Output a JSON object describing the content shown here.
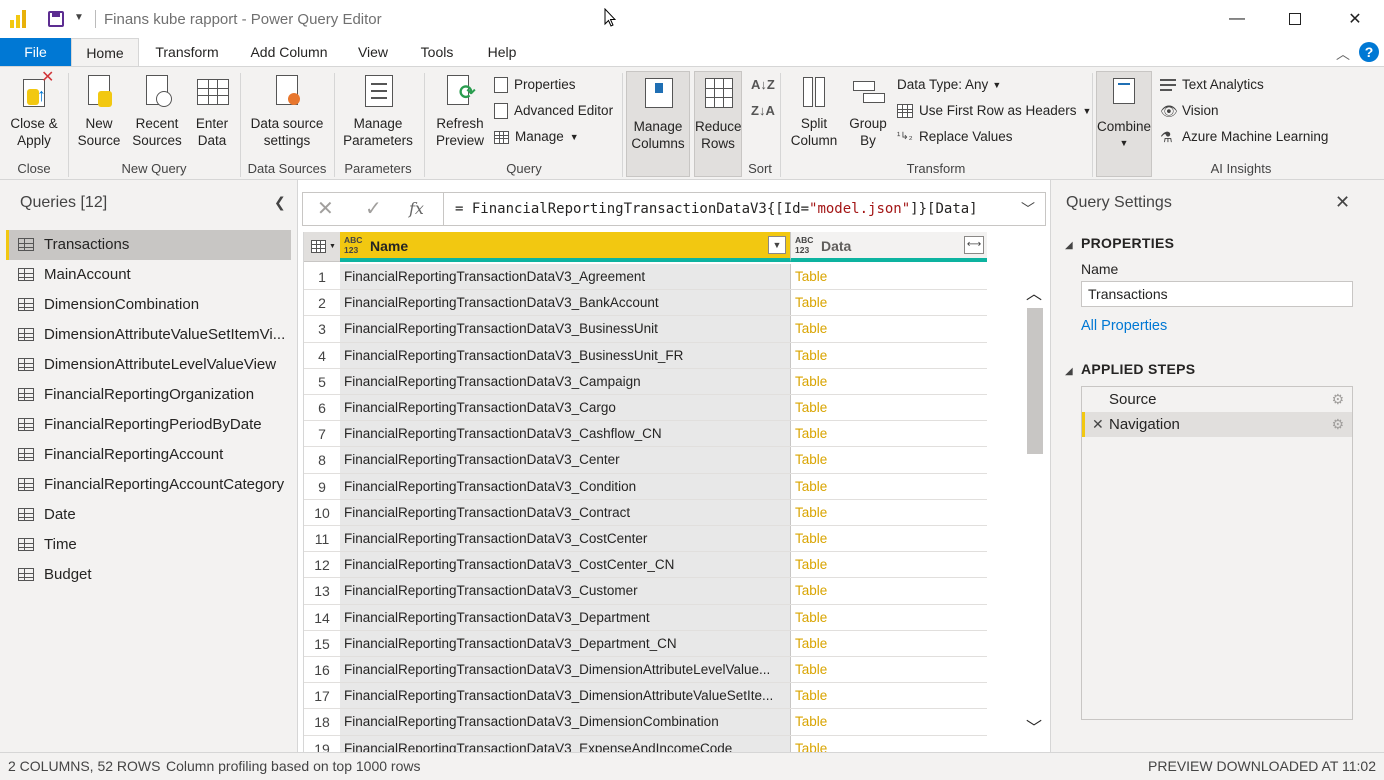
{
  "window": {
    "title": "Finans kube rapport - Power Query Editor",
    "minimize": "—",
    "close": "✕"
  },
  "tabs": [
    {
      "label": "File"
    },
    {
      "label": "Home"
    },
    {
      "label": "Transform"
    },
    {
      "label": "Add Column"
    },
    {
      "label": "View"
    },
    {
      "label": "Tools"
    },
    {
      "label": "Help"
    }
  ],
  "ribbon": {
    "close_apply": "Close &\nApply",
    "new_source": "New\nSource",
    "recent_sources": "Recent\nSources",
    "enter_data": "Enter\nData",
    "data_source_settings": "Data source\nsettings",
    "manage_parameters": "Manage\nParameters",
    "refresh_preview": "Refresh\nPreview",
    "properties": "Properties",
    "advanced_editor": "Advanced Editor",
    "manage": "Manage",
    "manage_columns": "Manage\nColumns",
    "reduce_rows": "Reduce\nRows",
    "split_column": "Split\nColumn",
    "group_by": "Group\nBy",
    "data_type": "Data Type: Any",
    "use_first_row": "Use First Row as Headers",
    "replace_values": "Replace Values",
    "combine": "Combine",
    "text_analytics": "Text Analytics",
    "vision": "Vision",
    "azure_ml": "Azure Machine Learning",
    "groups": {
      "close": "Close",
      "new_query": "New Query",
      "data_sources": "Data Sources",
      "parameters": "Parameters",
      "query": "Query",
      "sort": "Sort",
      "transform": "Transform",
      "ai_insights": "AI Insights"
    }
  },
  "queries": {
    "title": "Queries [12]",
    "items": [
      "Transactions",
      "MainAccount",
      "DimensionCombination",
      "DimensionAttributeValueSetItemVi...",
      "DimensionAttributeLevelValueView",
      "FinancialReportingOrganization",
      "FinancialReportingPeriodByDate",
      "FinancialReportingAccount",
      "FinancialReportingAccountCategory",
      "Date",
      "Time",
      "Budget"
    ],
    "selected": "Transactions"
  },
  "formula": {
    "prefix": "= FinancialReportingTransactionDataV3{[Id=",
    "string": "\"model.json\"",
    "suffix": "]}[Data]"
  },
  "grid": {
    "columns": [
      {
        "type": "ABC\n123",
        "name": "Name"
      },
      {
        "type": "ABC\n123",
        "name": "Data"
      }
    ],
    "rows": [
      [
        "1",
        "FinancialReportingTransactionDataV3_Agreement",
        "Table"
      ],
      [
        "2",
        "FinancialReportingTransactionDataV3_BankAccount",
        "Table"
      ],
      [
        "3",
        "FinancialReportingTransactionDataV3_BusinessUnit",
        "Table"
      ],
      [
        "4",
        "FinancialReportingTransactionDataV3_BusinessUnit_FR",
        "Table"
      ],
      [
        "5",
        "FinancialReportingTransactionDataV3_Campaign",
        "Table"
      ],
      [
        "6",
        "FinancialReportingTransactionDataV3_Cargo",
        "Table"
      ],
      [
        "7",
        "FinancialReportingTransactionDataV3_Cashflow_CN",
        "Table"
      ],
      [
        "8",
        "FinancialReportingTransactionDataV3_Center",
        "Table"
      ],
      [
        "9",
        "FinancialReportingTransactionDataV3_Condition",
        "Table"
      ],
      [
        "10",
        "FinancialReportingTransactionDataV3_Contract",
        "Table"
      ],
      [
        "11",
        "FinancialReportingTransactionDataV3_CostCenter",
        "Table"
      ],
      [
        "12",
        "FinancialReportingTransactionDataV3_CostCenter_CN",
        "Table"
      ],
      [
        "13",
        "FinancialReportingTransactionDataV3_Customer",
        "Table"
      ],
      [
        "14",
        "FinancialReportingTransactionDataV3_Department",
        "Table"
      ],
      [
        "15",
        "FinancialReportingTransactionDataV3_Department_CN",
        "Table"
      ],
      [
        "16",
        "FinancialReportingTransactionDataV3_DimensionAttributeLevelValue...",
        "Table"
      ],
      [
        "17",
        "FinancialReportingTransactionDataV3_DimensionAttributeValueSetIte...",
        "Table"
      ],
      [
        "18",
        "FinancialReportingTransactionDataV3_DimensionCombination",
        "Table"
      ],
      [
        "19",
        "FinancialReportingTransactionDataV3_ExpenseAndIncomeCode",
        "Table"
      ]
    ]
  },
  "settings": {
    "title": "Query Settings",
    "properties_header": "PROPERTIES",
    "name_label": "Name",
    "name_value": "Transactions",
    "all_properties": "All Properties",
    "steps_header": "APPLIED STEPS",
    "steps": [
      "Source",
      "Navigation"
    ],
    "active_step": "Navigation"
  },
  "status": {
    "summary": "2 COLUMNS, 52 ROWS",
    "profiling": "Column profiling based on top 1000 rows",
    "preview": "PREVIEW DOWNLOADED AT 11:02"
  },
  "colors": {
    "accent": "#f2c811",
    "file_tab": "#0078d4",
    "table_link": "#d9a400",
    "header_underline": "#0db3a0"
  }
}
